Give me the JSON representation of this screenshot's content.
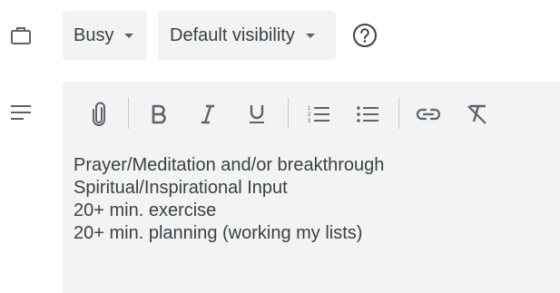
{
  "availability": {
    "icon": "briefcase-icon",
    "status_label": "Busy",
    "visibility_label": "Default visibility",
    "help_icon": "help-circle-icon"
  },
  "description": {
    "icon": "notes-lines-icon",
    "toolbar": [
      "attach-icon",
      "bold-icon",
      "italic-icon",
      "underline-icon",
      "numbered-list-icon",
      "bulleted-list-icon",
      "link-icon",
      "clear-formatting-icon"
    ],
    "lines": [
      "Prayer/Meditation and/or breakthrough",
      "Spiritual/Inspirational Input",
      "20+ min. exercise",
      "20+ min. planning (working my lists)"
    ]
  },
  "colors": {
    "field_bg": "#f1f3f4",
    "icon": "#5f6368",
    "text": "#3c4043"
  }
}
